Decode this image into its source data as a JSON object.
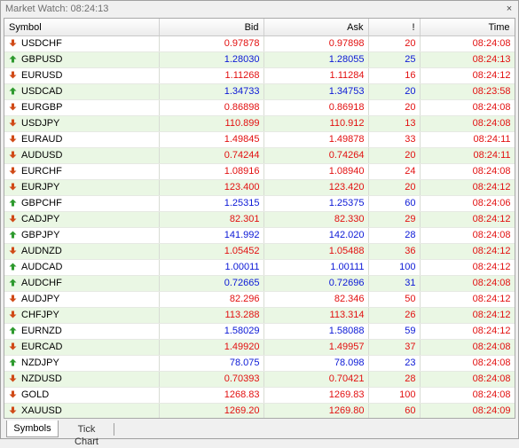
{
  "window": {
    "title": "Market Watch: 08:24:13",
    "close_label": "×"
  },
  "table": {
    "headers": {
      "symbol": "Symbol",
      "bid": "Bid",
      "ask": "Ask",
      "spread": "!",
      "time": "Time"
    },
    "rows": [
      {
        "symbol": "USDCHF",
        "bid": "0.97878",
        "ask": "0.97898",
        "spread": "20",
        "time": "08:24:08",
        "dir": "down"
      },
      {
        "symbol": "GBPUSD",
        "bid": "1.28030",
        "ask": "1.28055",
        "spread": "25",
        "time": "08:24:13",
        "dir": "up"
      },
      {
        "symbol": "EURUSD",
        "bid": "1.11268",
        "ask": "1.11284",
        "spread": "16",
        "time": "08:24:12",
        "dir": "down"
      },
      {
        "symbol": "USDCAD",
        "bid": "1.34733",
        "ask": "1.34753",
        "spread": "20",
        "time": "08:23:58",
        "dir": "up"
      },
      {
        "symbol": "EURGBP",
        "bid": "0.86898",
        "ask": "0.86918",
        "spread": "20",
        "time": "08:24:08",
        "dir": "down"
      },
      {
        "symbol": "USDJPY",
        "bid": "110.899",
        "ask": "110.912",
        "spread": "13",
        "time": "08:24:08",
        "dir": "down"
      },
      {
        "symbol": "EURAUD",
        "bid": "1.49845",
        "ask": "1.49878",
        "spread": "33",
        "time": "08:24:11",
        "dir": "down"
      },
      {
        "symbol": "AUDUSD",
        "bid": "0.74244",
        "ask": "0.74264",
        "spread": "20",
        "time": "08:24:11",
        "dir": "down"
      },
      {
        "symbol": "EURCHF",
        "bid": "1.08916",
        "ask": "1.08940",
        "spread": "24",
        "time": "08:24:08",
        "dir": "down"
      },
      {
        "symbol": "EURJPY",
        "bid": "123.400",
        "ask": "123.420",
        "spread": "20",
        "time": "08:24:12",
        "dir": "down"
      },
      {
        "symbol": "GBPCHF",
        "bid": "1.25315",
        "ask": "1.25375",
        "spread": "60",
        "time": "08:24:06",
        "dir": "up"
      },
      {
        "symbol": "CADJPY",
        "bid": "82.301",
        "ask": "82.330",
        "spread": "29",
        "time": "08:24:12",
        "dir": "down"
      },
      {
        "symbol": "GBPJPY",
        "bid": "141.992",
        "ask": "142.020",
        "spread": "28",
        "time": "08:24:08",
        "dir": "up"
      },
      {
        "symbol": "AUDNZD",
        "bid": "1.05452",
        "ask": "1.05488",
        "spread": "36",
        "time": "08:24:12",
        "dir": "down"
      },
      {
        "symbol": "AUDCAD",
        "bid": "1.00011",
        "ask": "1.00111",
        "spread": "100",
        "time": "08:24:12",
        "dir": "up"
      },
      {
        "symbol": "AUDCHF",
        "bid": "0.72665",
        "ask": "0.72696",
        "spread": "31",
        "time": "08:24:08",
        "dir": "up"
      },
      {
        "symbol": "AUDJPY",
        "bid": "82.296",
        "ask": "82.346",
        "spread": "50",
        "time": "08:24:12",
        "dir": "down"
      },
      {
        "symbol": "CHFJPY",
        "bid": "113.288",
        "ask": "113.314",
        "spread": "26",
        "time": "08:24:12",
        "dir": "down"
      },
      {
        "symbol": "EURNZD",
        "bid": "1.58029",
        "ask": "1.58088",
        "spread": "59",
        "time": "08:24:12",
        "dir": "up"
      },
      {
        "symbol": "EURCAD",
        "bid": "1.49920",
        "ask": "1.49957",
        "spread": "37",
        "time": "08:24:08",
        "dir": "down"
      },
      {
        "symbol": "NZDJPY",
        "bid": "78.075",
        "ask": "78.098",
        "spread": "23",
        "time": "08:24:08",
        "dir": "up"
      },
      {
        "symbol": "NZDUSD",
        "bid": "0.70393",
        "ask": "0.70421",
        "spread": "28",
        "time": "08:24:08",
        "dir": "down"
      },
      {
        "symbol": "GOLD",
        "bid": "1268.83",
        "ask": "1269.83",
        "spread": "100",
        "time": "08:24:08",
        "dir": "down"
      },
      {
        "symbol": "XAUUSD",
        "bid": "1269.20",
        "ask": "1269.80",
        "spread": "60",
        "time": "08:24:09",
        "dir": "down"
      }
    ]
  },
  "tabs": [
    {
      "label": "Symbols",
      "active": true
    },
    {
      "label": "Tick Chart",
      "active": false
    }
  ],
  "colors": {
    "up": "#0b18d6",
    "down": "#e21010",
    "arrow_up": "#2e9a2e",
    "arrow_down": "#d04a17",
    "alt_row": "#eaf7e4"
  },
  "icons": {
    "up": "arrow-up-icon",
    "down": "arrow-down-icon"
  }
}
